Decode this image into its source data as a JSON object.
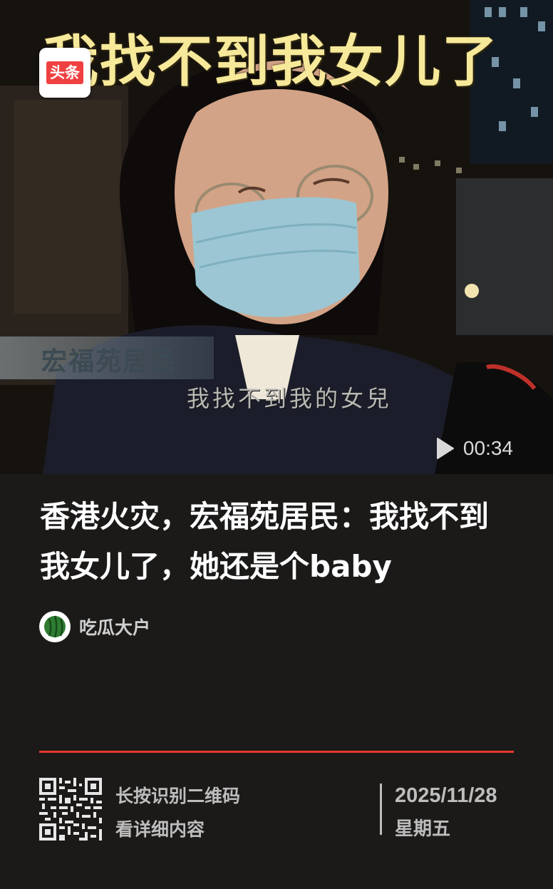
{
  "video": {
    "caption_top": "我找不到我女儿了",
    "badge_label": "头条",
    "tv_label": "宏福苑居民",
    "subtitle": "我找不到我的女兒",
    "duration": "00:34",
    "play_icon": "play-icon"
  },
  "article": {
    "title": "香港火灾，宏福苑居民：我找不到我女儿了，她还是个baby",
    "author": "吃瓜大户",
    "avatar_icon": "watermelon-avatar"
  },
  "footer": {
    "qr_line1": "长按识别二维码",
    "qr_line2": "看详细内容",
    "date": "2025/11/28",
    "weekday": "星期五",
    "accent_color": "#e8392f"
  }
}
